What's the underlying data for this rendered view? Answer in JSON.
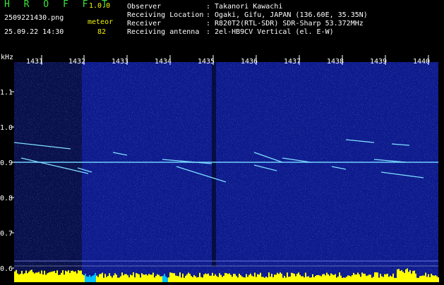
{
  "header": {
    "logo_text": "H R O F F T",
    "version": "1.0.0",
    "file_name": "2509221430.png",
    "meteor_label": "meteor",
    "datetime": "25.09.22 14:30",
    "meteor_count": "82",
    "info": [
      {
        "label": "Observer",
        "value": ": Takanori Kawachi"
      },
      {
        "label": "Receiving Location",
        "value": ": Ogaki, Gifu, JAPAN (136.60E, 35.35N)"
      },
      {
        "label": "Receiver",
        "value": ": R820T2(RTL-SDR) SDR-Sharp 53.372MHz"
      },
      {
        "label": "Receiving antenna",
        "value": ": 2el-HB9CV Vertical (el. E-W)"
      }
    ]
  },
  "plot": {
    "unit_label": "kHz",
    "time_labels": [
      "1431",
      "1432",
      "1433",
      "1434",
      "1435",
      "1436",
      "1437",
      "1438",
      "1439",
      "1440"
    ],
    "freq_labels": [
      "1.1",
      "1.0",
      "0.9",
      "0.8",
      "0.7",
      "0.6"
    ],
    "colors": {
      "background": "#0d1a8c",
      "dark_strip": "#080f4a",
      "carrier": "#6fd0ff",
      "trail": "#7fe0ff",
      "noise_floor": "#ffff00",
      "noise_floor_alt": "#00c0ff",
      "axis_text": "#ffffff"
    }
  }
}
